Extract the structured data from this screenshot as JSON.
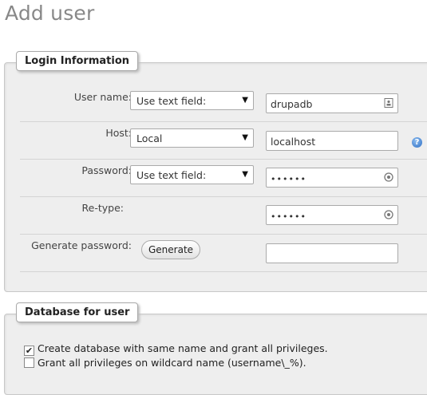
{
  "page": {
    "title": "Add user"
  },
  "login": {
    "legend": "Login Information",
    "username": {
      "label": "User name:",
      "select": "Use text field:",
      "value": "drupadb"
    },
    "host": {
      "label": "Host:",
      "select": "Local",
      "value": "localhost"
    },
    "password": {
      "label": "Password:",
      "select": "Use text field:",
      "value": "••••••"
    },
    "retype": {
      "label": "Re-type:",
      "value": "••••••"
    },
    "generate": {
      "label": "Generate password:",
      "button": "Generate",
      "value": ""
    }
  },
  "database": {
    "legend": "Database for user",
    "options": [
      {
        "label": "Create database with same name and grant all privileges.",
        "checked": true
      },
      {
        "label": "Grant all privileges on wildcard name (username\\_%).",
        "checked": false
      }
    ]
  }
}
